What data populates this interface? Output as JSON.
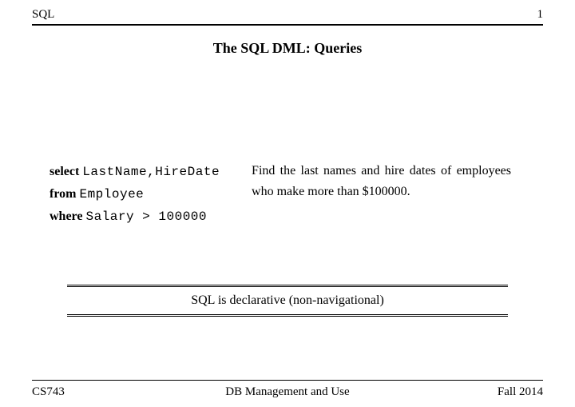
{
  "header": {
    "left": "SQL",
    "right": "1"
  },
  "title": "The SQL DML: Queries",
  "query": {
    "line1_kw": "select",
    "line1_code": "LastName,HireDate",
    "line2_kw": "from",
    "line2_code": "Employee",
    "line3_kw": "where",
    "line3_code": "Salary > 100000"
  },
  "description": "Find the last names and hire dates of employees who make more than $100000.",
  "callout": "SQL is declarative (non-navigational)",
  "footer": {
    "left": "CS743",
    "center": "DB Management and Use",
    "right": "Fall 2014"
  }
}
